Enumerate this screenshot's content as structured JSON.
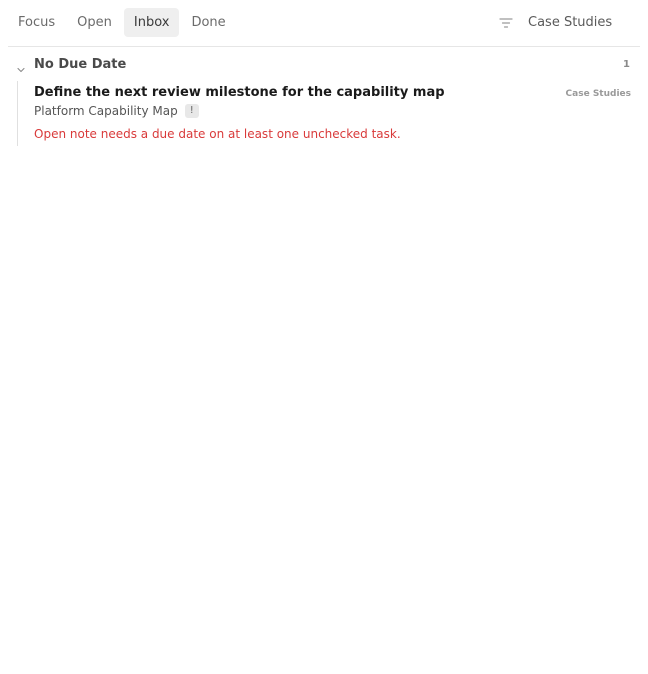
{
  "tabs": [
    {
      "label": "Focus",
      "active": false
    },
    {
      "label": "Open",
      "active": false
    },
    {
      "label": "Inbox",
      "active": true
    },
    {
      "label": "Done",
      "active": false
    }
  ],
  "filter": {
    "icon": "filter-icon",
    "label": "Case Studies"
  },
  "group": {
    "title": "No Due Date",
    "count": "1",
    "collapsed": false,
    "icon": "chevron-down-icon"
  },
  "task": {
    "title": "Define the next review milestone for the capability map",
    "tag": "Case Studies",
    "project": "Platform Capability Map",
    "priority": "!",
    "warning": "Open note needs a due date on at least one unchecked task."
  },
  "colors": {
    "warning": "#d93a3a",
    "active_tab_bg": "#efefef",
    "divider": "#e6e6e6"
  }
}
